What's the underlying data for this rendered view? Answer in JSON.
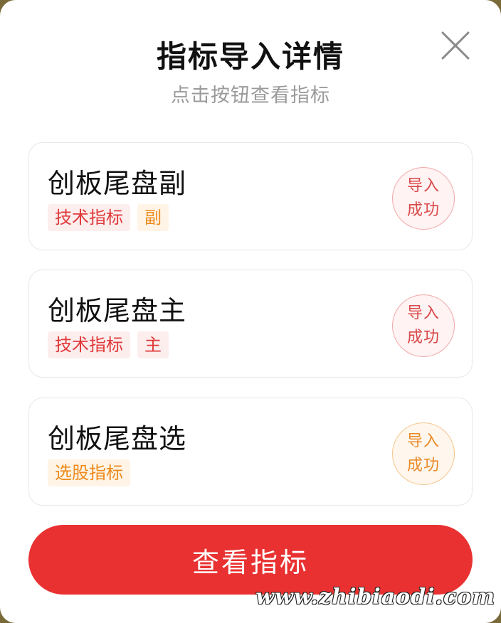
{
  "dialog": {
    "title": "指标导入详情",
    "subtitle": "点击按钮查看指标"
  },
  "cards": [
    {
      "title": "创板尾盘副",
      "tags": [
        {
          "label": "技术指标",
          "color": "#e0393a"
        },
        {
          "label": "副",
          "color": "#ee8a1c"
        }
      ],
      "status": {
        "line1": "导入",
        "line2": "成功",
        "color": "#d9484a"
      }
    },
    {
      "title": "创板尾盘主",
      "tags": [
        {
          "label": "技术指标",
          "color": "#e0393a"
        },
        {
          "label": "主",
          "color": "#e0393a"
        }
      ],
      "status": {
        "line1": "导入",
        "line2": "成功",
        "color": "#d9484a"
      }
    },
    {
      "title": "创板尾盘选",
      "tags": [
        {
          "label": "选股指标",
          "color": "#ee8a1c"
        }
      ],
      "status": {
        "line1": "导入",
        "line2": "成功",
        "color": "#ea8a28"
      }
    }
  ],
  "action": {
    "view_label": "查看指标",
    "color": "#e93131"
  },
  "watermark": "www.zhibiaodi.com",
  "icons": {
    "close": "close-icon"
  }
}
